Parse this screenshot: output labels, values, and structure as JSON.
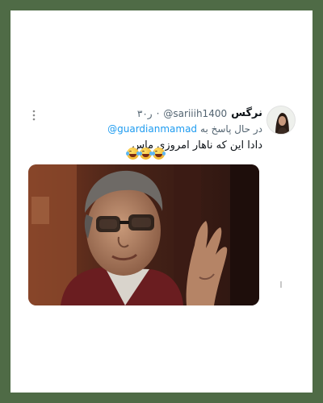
{
  "tweet": {
    "display_name": "نرگس",
    "handle": "@sariiih1400",
    "separator": "·",
    "time": "۳۰ر",
    "reply_prefix": "در حال پاسخ به",
    "reply_to": "@guardianmamad",
    "text": "دادا این که ناهار امروزی ماس",
    "emoji_count": 3,
    "emoji_name": "face-with-tears-of-joy"
  },
  "icons": {
    "more": "more-vertical-icon"
  },
  "colors": {
    "background_border": "#4f6b46",
    "card": "#ffffff",
    "link": "#1d9bf0",
    "muted": "#536471",
    "text": "#0f1419"
  }
}
